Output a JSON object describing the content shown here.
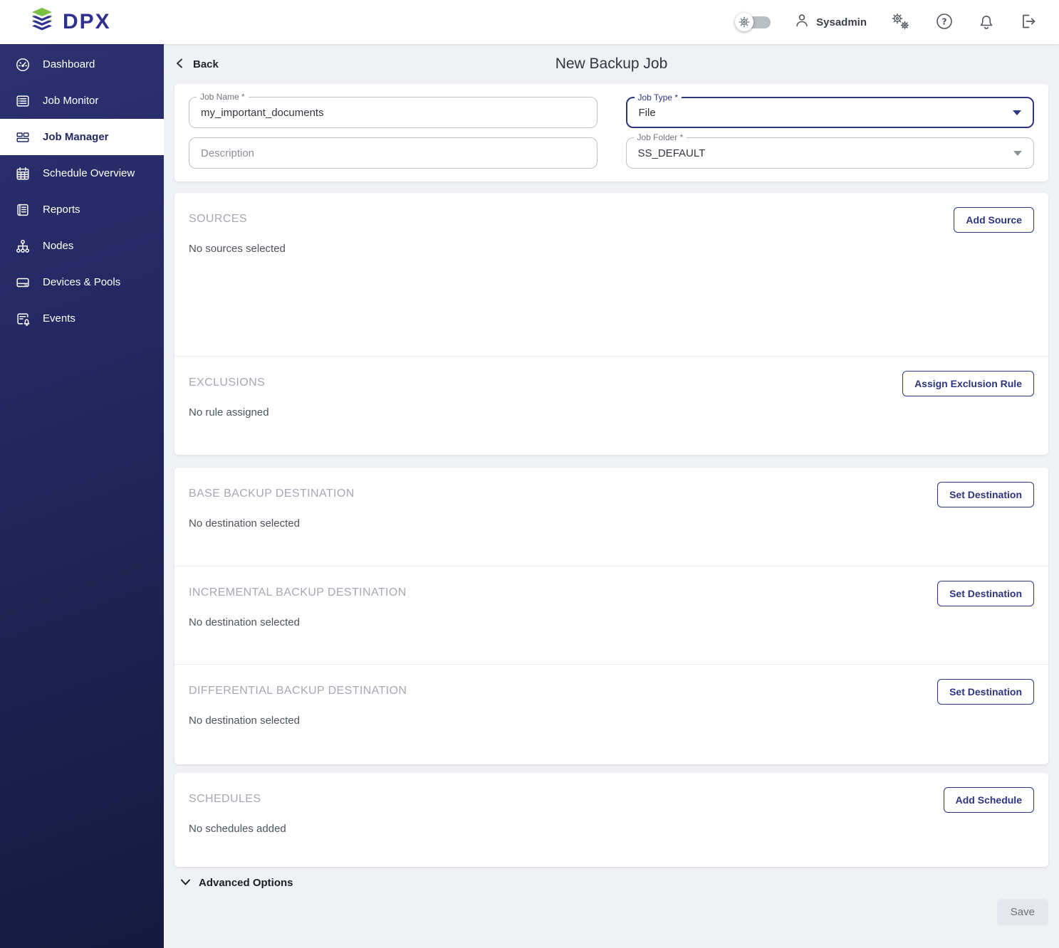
{
  "brand": {
    "name": "DPX"
  },
  "topbar": {
    "user": "Sysadmin",
    "icons": [
      "theme-toggle-gear",
      "user-avatar",
      "settings-gears",
      "help-question",
      "notifications-bell",
      "logout-arrow"
    ]
  },
  "sidebar": {
    "items": [
      {
        "label": "Dashboard",
        "icon": "gauge-icon",
        "active": false
      },
      {
        "label": "Job Monitor",
        "icon": "list-panel-icon",
        "active": false
      },
      {
        "label": "Job Manager",
        "icon": "board-icon",
        "active": true
      },
      {
        "label": "Schedule Overview",
        "icon": "calendar-icon",
        "active": false
      },
      {
        "label": "Reports",
        "icon": "newspaper-icon",
        "active": false
      },
      {
        "label": "Nodes",
        "icon": "hierarchy-icon",
        "active": false
      },
      {
        "label": "Devices & Pools",
        "icon": "harddrive-icon",
        "active": false
      },
      {
        "label": "Events",
        "icon": "list-bell-icon",
        "active": false
      }
    ]
  },
  "page": {
    "back_label": "Back",
    "title": "New Backup Job"
  },
  "form": {
    "job_name": {
      "label": "Job Name *",
      "value": "my_important_documents"
    },
    "description": {
      "placeholder": "Description"
    },
    "job_type": {
      "label": "Job Type *",
      "value": "File",
      "focused": true
    },
    "job_folder": {
      "label": "Job Folder *",
      "value": "SS_DEFAULT"
    }
  },
  "sections": [
    {
      "title": "SOURCES",
      "button": "Add Source",
      "empty": "No sources selected"
    },
    {
      "title": "EXCLUSIONS",
      "button": "Assign Exclusion Rule",
      "empty": "No rule assigned"
    },
    {
      "title": "BASE BACKUP DESTINATION",
      "button": "Set Destination",
      "empty": "No destination selected"
    },
    {
      "title": "INCREMENTAL BACKUP DESTINATION",
      "button": "Set Destination",
      "empty": "No destination selected"
    },
    {
      "title": "DIFFERENTIAL BACKUP DESTINATION",
      "button": "Set Destination",
      "empty": "No destination selected"
    },
    {
      "title": "SCHEDULES",
      "button": "Add Schedule",
      "empty": "No schedules added"
    }
  ],
  "advanced": {
    "label": "Advanced Options"
  },
  "footer": {
    "save_label": "Save",
    "save_enabled": false
  },
  "colors": {
    "accent_navy": "#2d3581",
    "logo_navy": "#2e3192",
    "logo_green": "#7ac143",
    "sidebar_top": "#2c3170",
    "sidebar_bottom": "#161a3e",
    "page_bg": "#eff1f5",
    "section_title_gray": "#a6a9b3",
    "disabled_bg": "#e4e7eb"
  }
}
